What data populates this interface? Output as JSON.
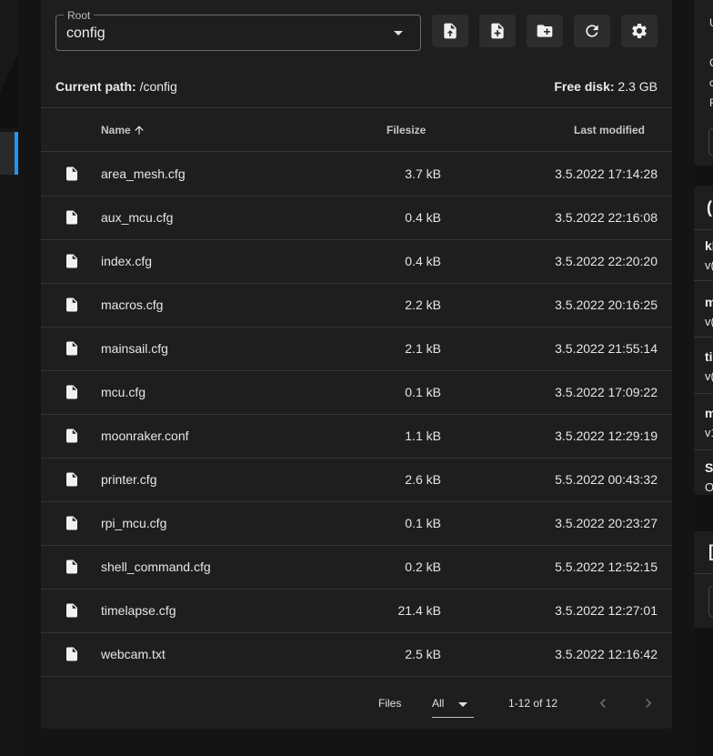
{
  "root": {
    "label": "Root",
    "value": "config"
  },
  "toolbar": {
    "upload_icon": "upload-file-icon",
    "new_file_icon": "create-file-icon",
    "new_folder_icon": "create-folder-icon",
    "refresh_icon": "refresh-icon",
    "settings_icon": "gear-icon"
  },
  "info": {
    "path_label": "Current path:",
    "path_value": "/config",
    "disk_label": "Free disk:",
    "disk_value": "2.3 GB"
  },
  "table": {
    "headers": {
      "name": "Name",
      "filesize": "Filesize",
      "modified": "Last modified",
      "sort_icon": "arrow-up-icon"
    },
    "rows": [
      {
        "name": "area_mesh.cfg",
        "size": "3.7 kB",
        "modified": "3.5.2022 17:14:28"
      },
      {
        "name": "aux_mcu.cfg",
        "size": "0.4 kB",
        "modified": "3.5.2022 22:16:08"
      },
      {
        "name": "index.cfg",
        "size": "0.4 kB",
        "modified": "3.5.2022 22:20:20"
      },
      {
        "name": "macros.cfg",
        "size": "2.2 kB",
        "modified": "3.5.2022 20:16:25"
      },
      {
        "name": "mainsail.cfg",
        "size": "2.1 kB",
        "modified": "3.5.2022 21:55:14"
      },
      {
        "name": "mcu.cfg",
        "size": "0.1 kB",
        "modified": "3.5.2022 17:09:22"
      },
      {
        "name": "moonraker.conf",
        "size": "1.1 kB",
        "modified": "3.5.2022 12:29:19"
      },
      {
        "name": "printer.cfg",
        "size": "2.6 kB",
        "modified": "5.5.2022 00:43:32"
      },
      {
        "name": "rpi_mcu.cfg",
        "size": "0.1 kB",
        "modified": "3.5.2022 20:23:27"
      },
      {
        "name": "shell_command.cfg",
        "size": "0.2 kB",
        "modified": "5.5.2022 12:52:15"
      },
      {
        "name": "timelapse.cfg",
        "size": "21.4 kB",
        "modified": "3.5.2022 12:27:01"
      },
      {
        "name": "webcam.txt",
        "size": "2.5 kB",
        "modified": "3.5.2022 12:16:42"
      }
    ]
  },
  "footer": {
    "per_page_label": "Files",
    "per_page_value": "All",
    "range": "1-12 of 12"
  },
  "right_panel": {
    "top_lines": [
      "U",
      "C",
      "c",
      "F"
    ],
    "items": [
      {
        "title": "kl",
        "sub": "v("
      },
      {
        "title": "m",
        "sub": "v("
      },
      {
        "title": "ti",
        "sub": "v("
      },
      {
        "title": "m",
        "sub": "v1"
      },
      {
        "title": "S",
        "sub": "O"
      }
    ],
    "header_glyph": "(",
    "bottom_glyph": "["
  }
}
